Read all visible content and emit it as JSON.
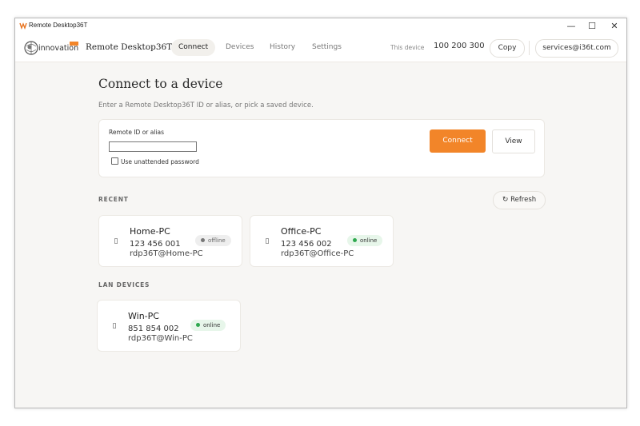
{
  "window": {
    "title": "Remote Desktop36T",
    "controls": {
      "minimize": "—",
      "maximize": "☐",
      "close": "✕"
    }
  },
  "nav": {
    "logo_text": "innovation",
    "app_name": "Remote Desktop36T",
    "tabs": [
      {
        "label": "Connect",
        "active": true
      },
      {
        "label": "Devices",
        "active": false
      },
      {
        "label": "History",
        "active": false
      },
      {
        "label": "Settings",
        "active": false
      }
    ],
    "this_device_label": "This device",
    "this_device_id": "100 200 300",
    "copy_label": "Copy",
    "account_email": "services@i36t.com"
  },
  "main": {
    "title": "Connect to a device",
    "subtitle": "Enter a Remote Desktop36T ID or alias, or pick a saved device.",
    "form": {
      "field_label": "Remote ID or alias",
      "input_value": "",
      "input_placeholder": "",
      "checkbox_label": "Use unattended password",
      "checkbox_checked": false,
      "connect_label": "Connect",
      "view_label": "View"
    },
    "recent_label": "RECENT",
    "refresh_label": "Refresh",
    "recent_devices": [
      {
        "name": "Home-PC",
        "id": "123 456 001",
        "user": "rdp36T@Home-PC",
        "status": "offline"
      },
      {
        "name": "Office-PC",
        "id": "123 456 002",
        "user": "rdp36T@Office-PC",
        "status": "online"
      }
    ],
    "lan_label": "LAN DEVICES",
    "lan_devices": [
      {
        "name": "Win-PC",
        "id": "851 854 002",
        "user": "rdp36T@Win-PC",
        "status": "online"
      }
    ]
  },
  "icons": {
    "device": "monitor-icon",
    "refresh": "refresh-icon",
    "status_dot": "status-dot-icon"
  },
  "colors": {
    "accent": "#f28529",
    "online_dot": "#2fa84f",
    "online_bg": "#e7f6ea",
    "offline_dot": "#777777",
    "offline_bg": "#eeeeee",
    "page_bg": "#f7f6f4"
  }
}
